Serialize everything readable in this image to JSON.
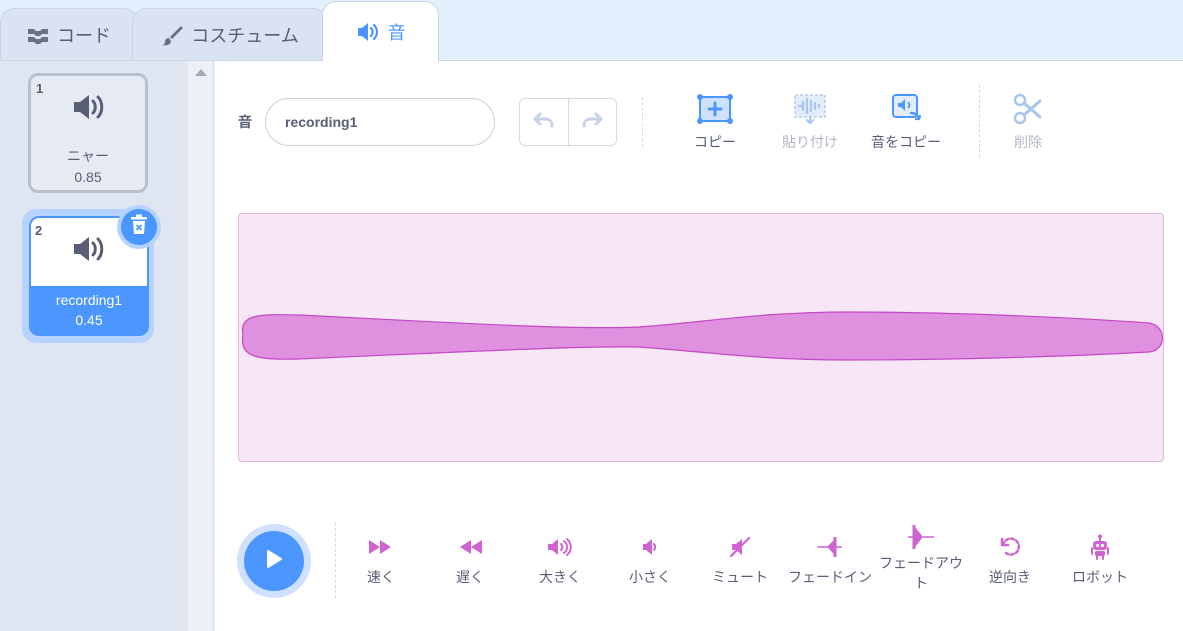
{
  "tabs": [
    {
      "label": "コード",
      "icon": "code-icon"
    },
    {
      "label": "コスチューム",
      "icon": "paintbrush-icon"
    },
    {
      "label": "音",
      "icon": "speaker-icon",
      "active": true
    }
  ],
  "sounds": [
    {
      "index": "1",
      "name": "ニャー",
      "duration": "0.85",
      "selected": false
    },
    {
      "index": "2",
      "name": "recording1",
      "duration": "0.45",
      "selected": true
    }
  ],
  "editor": {
    "sound_label": "音",
    "sound_name": "recording1"
  },
  "toolbar": {
    "copy": "コピー",
    "paste": "貼り付け",
    "copy_to_new": "音をコピー",
    "delete": "削除"
  },
  "effects": [
    {
      "label": "速く",
      "icon": "faster-icon"
    },
    {
      "label": "遅く",
      "icon": "slower-icon"
    },
    {
      "label": "大きく",
      "icon": "louder-icon"
    },
    {
      "label": "小さく",
      "icon": "softer-icon"
    },
    {
      "label": "ミュート",
      "icon": "mute-icon"
    },
    {
      "label": "フェードイン",
      "icon": "fade-in-icon"
    },
    {
      "label": "フェードアウト",
      "icon": "fade-out-icon"
    },
    {
      "label": "逆向き",
      "icon": "reverse-icon"
    },
    {
      "label": "ロボット",
      "icon": "robot-icon"
    }
  ],
  "colors": {
    "accent": "#4c97ff",
    "effect": "#cf63cf",
    "waveform_fill": "#df90df",
    "waveform_bg": "#f7e6f6"
  }
}
